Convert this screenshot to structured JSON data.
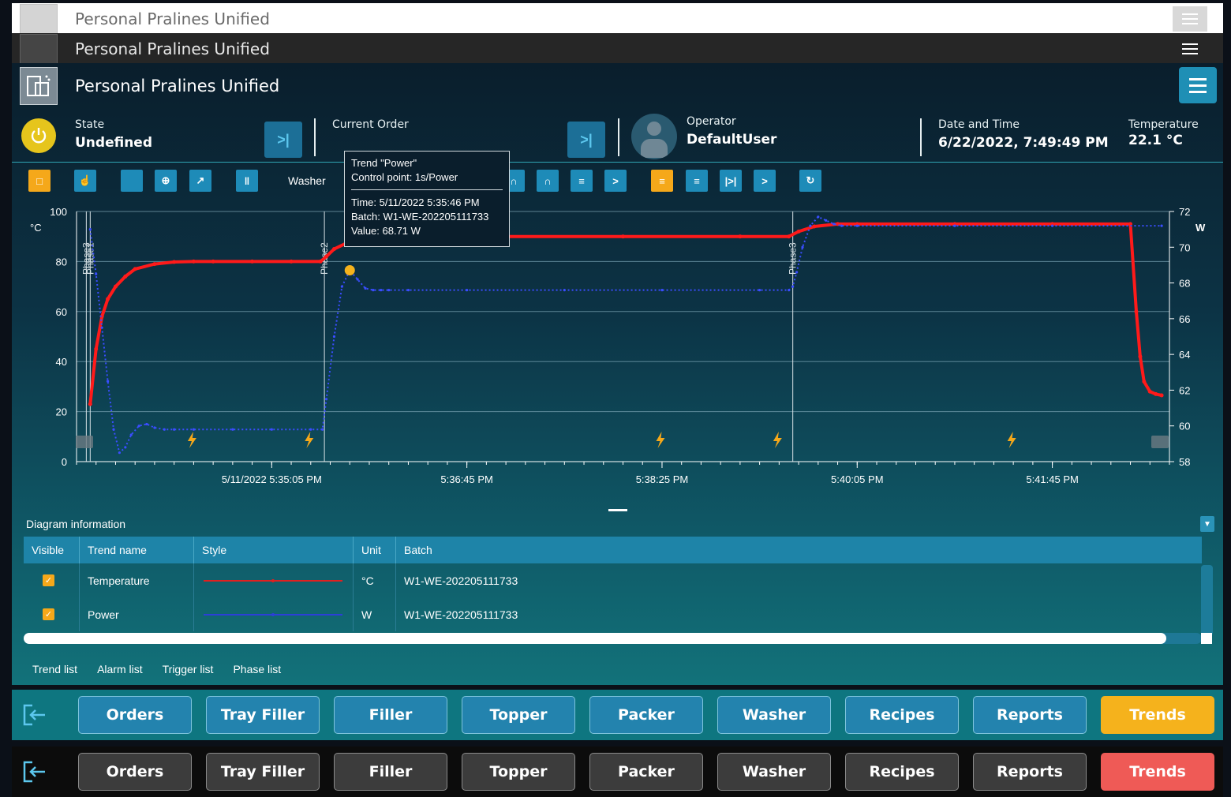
{
  "app": {
    "title": "Personal Pralines Unified"
  },
  "status": {
    "state_label": "State",
    "state_value": "Undefined",
    "order_label": "Current Order",
    "order_value": "",
    "operator_label": "Operator",
    "operator_value": "DefaultUser",
    "datetime_label": "Date and Time",
    "datetime_value": "6/22/2022, 7:49:49 PM",
    "temperature_label": "Temperature",
    "temperature_value": "22.1 °C"
  },
  "toolbar": {
    "source_label": "Washer",
    "icons": [
      "comment-icon",
      "touch-icon",
      "blank-icon",
      "zoom-icon",
      "expand-icon",
      "ruler-icon",
      "dropdown-icon",
      "download-icon",
      "dropdown-icon",
      "columns-icon",
      "columns-icon",
      "filter-icon",
      "chevron-right-icon",
      "align-left-icon",
      "align-left-icon",
      "skip-icon",
      "chevron-right-icon",
      "refresh-icon"
    ]
  },
  "chart_data": {
    "type": "line",
    "y_left_unit": "°C",
    "y_right_unit": "W",
    "ylim_left": [
      0,
      100
    ],
    "ylim_right": [
      58,
      72
    ],
    "y_left_ticks": [
      "0",
      "20",
      "40",
      "60",
      "80",
      "100"
    ],
    "y_right_ticks": [
      "58",
      "60",
      "62",
      "64",
      "66",
      "68",
      "70",
      "72"
    ],
    "x_tick_labels": [
      "5/11/2022 5:35:05 PM",
      "5:36:45 PM",
      "5:38:25 PM",
      "5:40:05 PM",
      "5:41:45 PM"
    ],
    "x_seconds_range": [
      0,
      560
    ],
    "x_tick_seconds": [
      100,
      200,
      300,
      400,
      500
    ],
    "phase_markers": [
      {
        "label": "Phase1",
        "t": 7
      },
      {
        "label": "Phase3",
        "t": 5
      },
      {
        "label": "Phase2",
        "t": 127
      },
      {
        "label": "Phase3",
        "t": 367
      }
    ],
    "alarm_markers_t": [
      59,
      119,
      299,
      359,
      479
    ],
    "series": [
      {
        "name": "Temperature",
        "unit": "°C",
        "color": "#ff1a1a",
        "x": [
          7,
          10,
          13,
          16,
          20,
          25,
          30,
          40,
          50,
          60,
          70,
          90,
          110,
          125,
          128,
          132,
          140,
          150,
          165,
          185,
          220,
          280,
          340,
          365,
          370,
          378,
          390,
          400,
          450,
          500,
          540,
          543,
          545,
          547,
          550,
          553,
          556
        ],
        "values": [
          23,
          45,
          58,
          65,
          70,
          74,
          77,
          79,
          79.8,
          80,
          80,
          80,
          80,
          80,
          82,
          85,
          88,
          89.5,
          90,
          90,
          90,
          90,
          90,
          90,
          92,
          94,
          95,
          95,
          95,
          95,
          95,
          60,
          42,
          32,
          28,
          27,
          26.5
        ]
      },
      {
        "name": "Power",
        "unit": "W",
        "color": "#3a4dff",
        "x": [
          7,
          10,
          13,
          16,
          19,
          22,
          25,
          28,
          32,
          36,
          40,
          45,
          50,
          60,
          80,
          100,
          120,
          126,
          128,
          132,
          136,
          140,
          144,
          148,
          152,
          156,
          160,
          170,
          200,
          250,
          300,
          350,
          365,
          367,
          369,
          372,
          376,
          380,
          384,
          388,
          392,
          400,
          450,
          500,
          556
        ],
        "values": [
          71,
          68.5,
          65.5,
          62.5,
          59.8,
          58.5,
          58.8,
          59.5,
          60,
          60.1,
          59.9,
          59.8,
          59.8,
          59.8,
          59.8,
          59.8,
          59.8,
          59.8,
          61.5,
          65,
          67.8,
          68.71,
          68.2,
          67.7,
          67.6,
          67.6,
          67.6,
          67.6,
          67.6,
          67.6,
          67.6,
          67.6,
          67.6,
          67.8,
          68.6,
          70,
          71.2,
          71.7,
          71.5,
          71.3,
          71.2,
          71.2,
          71.2,
          71.2,
          71.2
        ]
      }
    ],
    "highlight_point": {
      "series": "Power",
      "t": 140,
      "value": 68.71
    }
  },
  "tooltip": {
    "title": "Trend \"Power\"",
    "control_point": "Control point: 1s/Power",
    "time": "Time: 5/11/2022 5:35:46 PM",
    "batch": "Batch: W1-WE-202205111733",
    "value": "Value: 68.71 W"
  },
  "diagram_info": {
    "title": "Diagram information",
    "columns": [
      "Visible",
      "Trend name",
      "Style",
      "Unit",
      "Batch"
    ],
    "rows": [
      {
        "trend": "Temperature",
        "unit": "°C",
        "batch": "W1-WE-202205111733",
        "color": "#e02020"
      },
      {
        "trend": "Power",
        "unit": "W",
        "batch": "W1-WE-202205111733",
        "color": "#2c3fd8"
      }
    ]
  },
  "tabs": [
    "Trend list",
    "Alarm list",
    "Trigger list",
    "Phase list"
  ],
  "nav": {
    "buttons": [
      "Orders",
      "Tray Filler",
      "Filler",
      "Topper",
      "Packer",
      "Washer",
      "Recipes",
      "Reports",
      "Trends"
    ],
    "active": "Trends"
  },
  "colors": {
    "accent": "#f5b21c",
    "active_alt": "#ef5a56",
    "primary_button": "#2383ae"
  }
}
